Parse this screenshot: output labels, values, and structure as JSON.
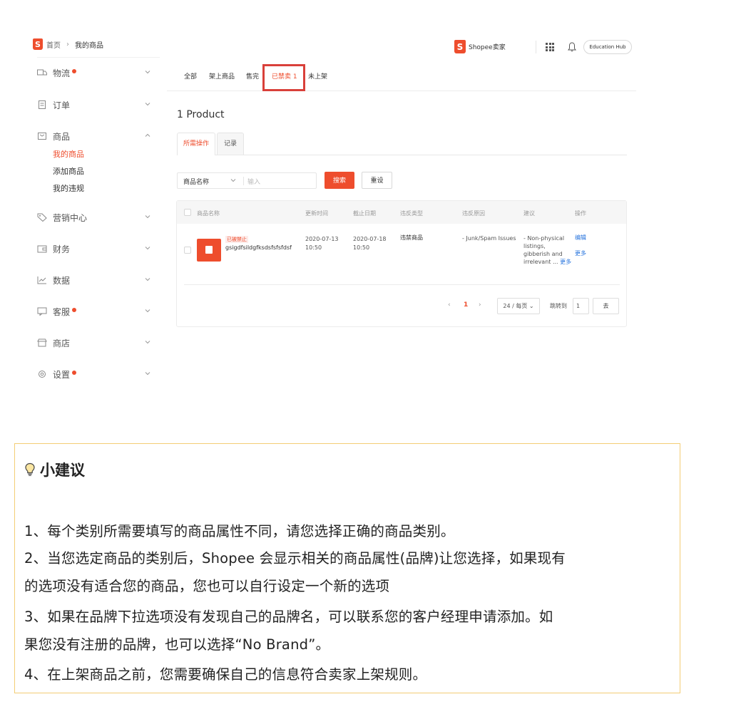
{
  "breadcrumb": {
    "home": "首页",
    "separator": "›",
    "current": "我的商品"
  },
  "header": {
    "brand_label": "Shopee卖家",
    "education_hub": "Education Hub"
  },
  "sidebar": {
    "items": [
      {
        "label": "物流",
        "has_dot": true
      },
      {
        "label": "订单",
        "has_dot": false
      },
      {
        "label": "商品",
        "has_dot": false
      },
      {
        "label": "营销中心",
        "has_dot": false
      },
      {
        "label": "财务",
        "has_dot": false
      },
      {
        "label": "数据",
        "has_dot": false
      },
      {
        "label": "客服",
        "has_dot": true
      },
      {
        "label": "商店",
        "has_dot": false
      },
      {
        "label": "设置",
        "has_dot": true
      }
    ],
    "product_sub": [
      "我的商品",
      "添加商品",
      "我的违规"
    ]
  },
  "tabs": [
    "全部",
    "架上商品",
    "售完",
    "已禁卖 1",
    "未上架"
  ],
  "product_count": "1 Product",
  "subtabs": [
    "所需操作",
    "记录"
  ],
  "filter": {
    "select_value": "商品名称",
    "placeholder": "输入"
  },
  "buttons": {
    "search": "搜索",
    "reset": "重设"
  },
  "table": {
    "headers": [
      "商品名称",
      "更新时间",
      "截止日期",
      "违反类型",
      "违反原因",
      "建议",
      "操作"
    ],
    "row": {
      "tag": "已被禁止",
      "name": "gsigdfsildgfksdsfsfsfdsf",
      "updated_date": "2020-07-13",
      "updated_time": "10:50",
      "deadline_date": "2020-07-18",
      "deadline_time": "10:50",
      "violation_type": "违禁商品",
      "violation_reason": "- Junk/Spam Issues",
      "suggestion_1": "- Non-physical",
      "suggestion_2": "listings,",
      "suggestion_3": "gibberish and",
      "suggestion_4": "irrelevant ...",
      "suggestion_more": "更多",
      "action_edit": "编辑",
      "action_more": "更多"
    }
  },
  "pagination": {
    "prev": "‹",
    "page": "1",
    "next": "›",
    "per_page": "24 / 每页",
    "jump_label": "跳转到",
    "jump_value": "1",
    "go": "去"
  },
  "tip": {
    "title": "小建议",
    "lines": [
      "1、每个类别所需要填写的商品属性不同，请您选择正确的商品类别。",
      "2、当您选定商品的类别后，Shopee 会显示相关的商品属性(品牌)让您选择，如果现有",
      "的选项没有适合您的商品，您也可以自行设定一个新的选项",
      "3、如果在品牌下拉选项没有发现自己的品牌名，可以联系您的客户经理申请添加。如",
      "果您没有注册的品牌，也可以选择“No Brand”。",
      "4、在上架商品之前，您需要确保自己的信息符合卖家上架规则。"
    ]
  },
  "colors": {
    "brand": "#ee4d2d",
    "link": "#2673dd",
    "tip_border": "#f3cd75",
    "highlight": "#d9403a"
  }
}
